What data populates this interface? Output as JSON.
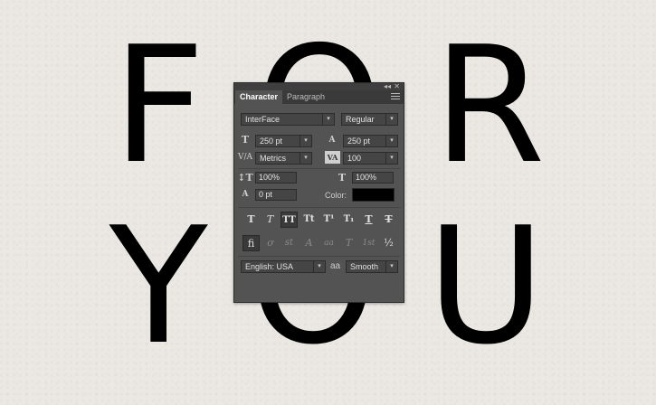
{
  "canvas": {
    "line1": "FOR",
    "line2": "YOU"
  },
  "panel": {
    "tabs": [
      "Character",
      "Paragraph"
    ],
    "font_family": "InterFace",
    "font_style": "Regular",
    "font_size": "250 pt",
    "leading": "250 pt",
    "kerning": "Metrics",
    "tracking": "100",
    "vertical_scale": "100%",
    "horizontal_scale": "100%",
    "baseline_shift": "0 pt",
    "color_label": "Color:",
    "language": "English: USA",
    "antialias_icon": "aa",
    "antialias": "Smooth",
    "style_buttons": [
      "T",
      "T",
      "TT",
      "Tt",
      "T¹",
      "T₁",
      "T",
      "T"
    ],
    "opentype_buttons": [
      "fi",
      "ơ",
      "st",
      "A",
      "aa",
      "T",
      "1st",
      "½"
    ]
  }
}
